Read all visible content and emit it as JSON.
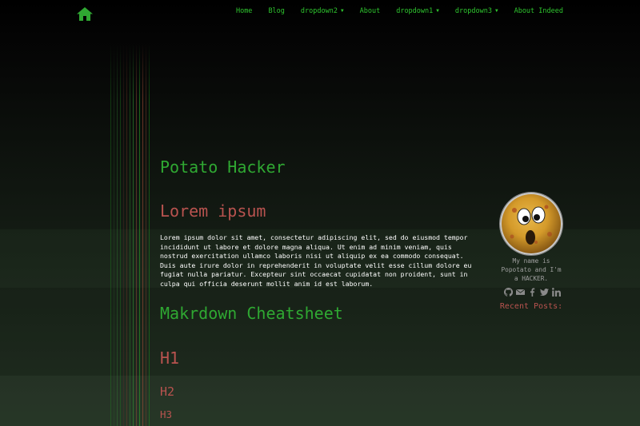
{
  "navbar": {
    "items": [
      {
        "label": "Home",
        "dropdown": false
      },
      {
        "label": "Blog",
        "dropdown": false
      },
      {
        "label": "dropdown2",
        "dropdown": true
      },
      {
        "label": "About",
        "dropdown": false
      },
      {
        "label": "dropdown1",
        "dropdown": true
      },
      {
        "label": "dropdown3",
        "dropdown": true
      },
      {
        "label": "About Indeed",
        "dropdown": false
      }
    ],
    "caret": "▼"
  },
  "main": {
    "site_title": "Potato Hacker",
    "lorem_heading": "Lorem ipsum",
    "lorem_text": "Lorem ipsum dolor sit amet, consectetur adipiscing elit, sed do eiusmod tempor incididunt ut labore et dolore magna aliqua. Ut enim ad minim veniam, quis nostrud exercitation ullamco laboris nisi ut aliquip ex ea commodo consequat. Duis aute irure dolor in reprehenderit in voluptate velit esse cillum dolore eu fugiat nulla pariatur. Excepteur sint occaecat cupidatat non proident, sunt in culpa qui officia deserunt mollit anim id est laborum.",
    "cheatsheet_heading": "Makrdown Cheatsheet",
    "h1": "H1",
    "h2": "H2",
    "h3": "H3"
  },
  "sidebar": {
    "bio": "My name is Popotato and I'm a HACKER.",
    "social_icons": [
      "github-icon",
      "email-icon",
      "facebook-icon",
      "twitter-icon",
      "linkedin-icon"
    ],
    "recent_posts_label": "Recent Posts:"
  },
  "colors": {
    "accent_green": "#2fa832",
    "nav_green": "#2fc62f",
    "accent_red": "#b9534f",
    "muted_text": "#a0a0a0"
  }
}
